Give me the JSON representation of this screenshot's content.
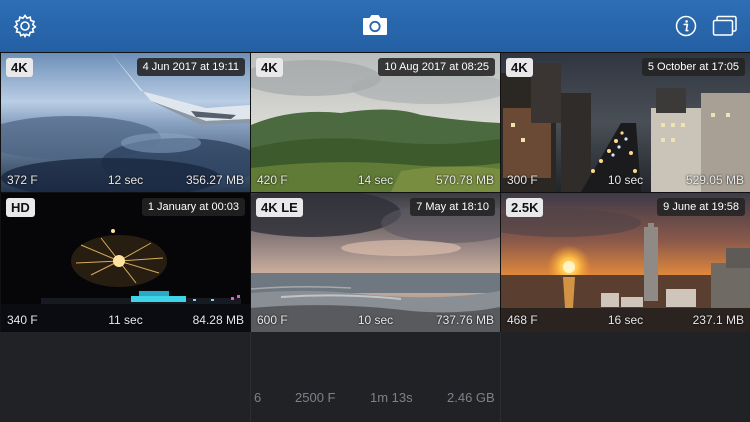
{
  "toolbar": {
    "settings_icon": "gear-icon",
    "camera_icon": "camera-icon",
    "info_icon": "info-icon",
    "albums_icon": "stacked-windows-icon",
    "bar_color": "#2a68ae"
  },
  "videos": [
    {
      "badge": "4K",
      "date": "4 Jun 2017 at 19:11",
      "frames": "372 F",
      "duration": "12 sec",
      "size": "356.27 MB"
    },
    {
      "badge": "4K",
      "date": "10 Aug 2017 at 08:25",
      "frames": "420 F",
      "duration": "14 sec",
      "size": "570.78 MB"
    },
    {
      "badge": "4K",
      "date": "5 October at 17:05",
      "frames": "300 F",
      "duration": "10 sec",
      "size": "529.05 MB"
    },
    {
      "badge": "HD",
      "date": "1 January at 00:03",
      "frames": "340 F",
      "duration": "11 sec",
      "size": "84.28 MB"
    },
    {
      "badge": "4K  LE",
      "date": "7 May at 18:10",
      "frames": "600 F",
      "duration": "10 sec",
      "size": "737.76 MB"
    },
    {
      "badge": "2.5K",
      "date": "9 June at 19:58",
      "frames": "468 F",
      "duration": "16 sec",
      "size": "237.1 MB"
    }
  ],
  "summary": {
    "count": "6",
    "frames": "2500 F",
    "duration": "1m 13s",
    "size": "2.46 GB"
  }
}
